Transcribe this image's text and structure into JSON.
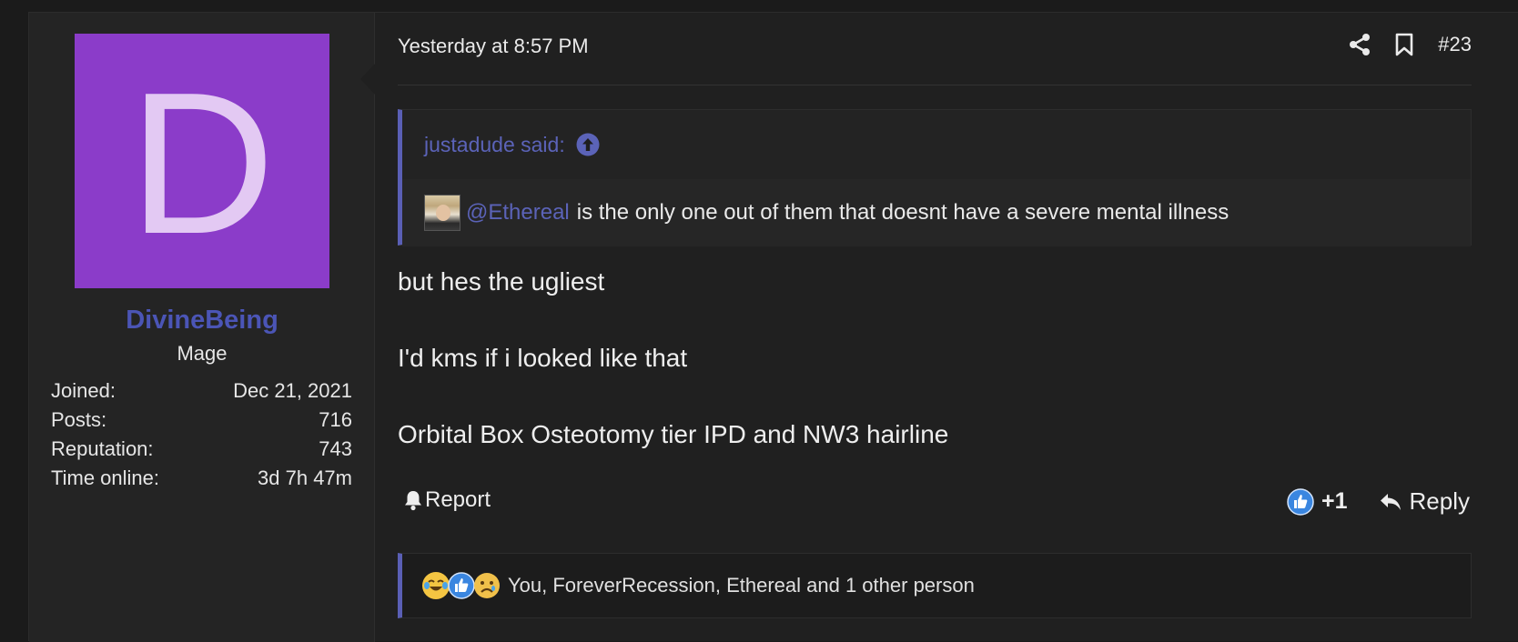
{
  "user": {
    "avatar_letter": "D",
    "avatar_color": "#8b3cc9",
    "username": "DivineBeing",
    "title": "Mage",
    "stats": [
      {
        "label": "Joined:",
        "value": "Dec 21, 2021"
      },
      {
        "label": "Posts:",
        "value": "716"
      },
      {
        "label": "Reputation:",
        "value": "743"
      },
      {
        "label": "Time online:",
        "value": "3d 7h 47m"
      }
    ]
  },
  "post": {
    "timestamp": "Yesterday at 8:57 PM",
    "number": "#23",
    "icons": {
      "share": "share-icon",
      "bookmark": "bookmark-icon"
    }
  },
  "quote": {
    "author_line": "justadude said:",
    "mention": "@Ethereal",
    "text": "is the only one out of them that doesnt have a severe mental illness"
  },
  "message": {
    "lines": [
      "but hes the ugliest",
      "I'd kms if i looked like that",
      "Orbital Box Osteotomy tier IPD and NW3 hairline"
    ]
  },
  "actions": {
    "report": "Report",
    "reaction_count": "+1",
    "reply": "Reply"
  },
  "reactions": {
    "text": "You, ForeverRecession, Ethereal and 1 other person"
  },
  "colors": {
    "accent": "#5a5fb5",
    "username": "#4b55b6"
  }
}
